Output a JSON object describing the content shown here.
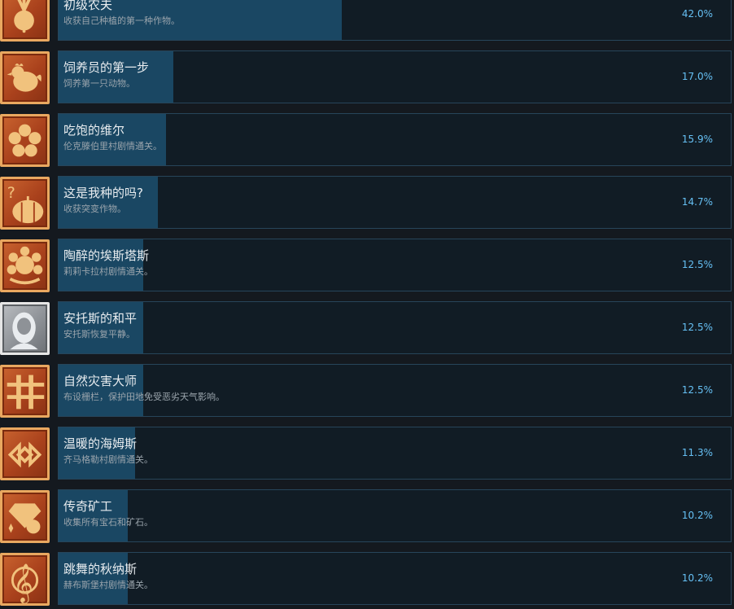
{
  "achievements": [
    {
      "title": "初级农夫",
      "desc": "收获自己种植的第一种作物。",
      "percent_label": "42.0%",
      "percent": 42.0,
      "icon": "turnip-icon",
      "tier": "bronze"
    },
    {
      "title": "饲养员的第一步",
      "desc": "饲养第一只动物。",
      "percent_label": "17.0%",
      "percent": 17.0,
      "icon": "chicken-icon",
      "tier": "bronze"
    },
    {
      "title": "吃饱的维尔",
      "desc": "伦克滕伯里村剧情通关。",
      "percent_label": "15.9%",
      "percent": 15.9,
      "icon": "flower-icon",
      "tier": "bronze"
    },
    {
      "title": "这是我种的吗?",
      "desc": "收获突变作物。",
      "percent_label": "14.7%",
      "percent": 14.7,
      "icon": "pumpkin-question-icon",
      "tier": "bronze"
    },
    {
      "title": "陶醉的埃斯塔斯",
      "desc": "莉莉卡拉村剧情通关。",
      "percent_label": "12.5%",
      "percent": 12.5,
      "icon": "sun-flower-icon",
      "tier": "bronze"
    },
    {
      "title": "安托斯的和平",
      "desc": "安托斯恢复平静。",
      "percent_label": "12.5%",
      "percent": 12.5,
      "icon": "maiden-icon",
      "tier": "silver"
    },
    {
      "title": "自然灾害大师",
      "desc": "布设栅栏，保护田地免受恶劣天气影响。",
      "percent_label": "12.5%",
      "percent": 12.5,
      "icon": "fence-icon",
      "tier": "bronze"
    },
    {
      "title": "温暖的海姆斯",
      "desc": "齐马格勒村剧情通关。",
      "percent_label": "11.3%",
      "percent": 11.3,
      "icon": "ornament-icon",
      "tier": "bronze"
    },
    {
      "title": "传奇矿工",
      "desc": "收集所有宝石和矿石。",
      "percent_label": "10.2%",
      "percent": 10.2,
      "icon": "gem-icon",
      "tier": "bronze"
    },
    {
      "title": "跳舞的秋纳斯",
      "desc": "赫布斯堡村剧情通关。",
      "percent_label": "10.2%",
      "percent": 10.2,
      "icon": "treble-clef-icon",
      "tier": "bronze"
    }
  ],
  "colors": {
    "bar": "#1a4763",
    "percent_text": "#66c0f4",
    "panel_border": "#27455a"
  }
}
